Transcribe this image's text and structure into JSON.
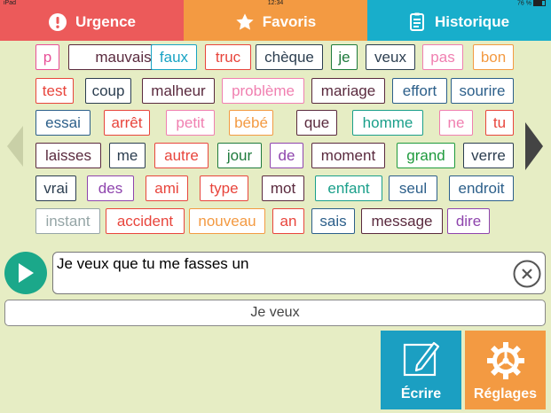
{
  "status": {
    "device": "iPad",
    "time": "12:34",
    "battery": "76 %"
  },
  "tabs": [
    {
      "label": "Urgence",
      "icon": "exclamation-circle-icon",
      "color": "#ec5a5a"
    },
    {
      "label": "Favoris",
      "icon": "star-icon",
      "color": "#f39a42"
    },
    {
      "label": "Historique",
      "icon": "history-list-icon",
      "color": "#18aecb"
    }
  ],
  "words": [
    [
      "p",
      "mauvais",
      "faux",
      "truc",
      "chèque",
      "je",
      "veux",
      "pas",
      "bon"
    ],
    [
      "test",
      "coup",
      "malheur",
      "problème",
      "mariage",
      "effort",
      "sourire"
    ],
    [
      "essai",
      "arrêt",
      "petit",
      "bébé",
      "que",
      "homme",
      "ne",
      "tu"
    ],
    [
      "laisses",
      "me",
      "autre",
      "jour",
      "de",
      "moment",
      "grand",
      "verre"
    ],
    [
      "vrai",
      "des",
      "ami",
      "type",
      "mot",
      "enfant",
      "seul",
      "endroit"
    ],
    [
      "instant",
      "accident",
      "nouveau",
      "an",
      "sais",
      "message",
      "dire"
    ]
  ],
  "message": {
    "text": "Je veux que tu me fasses un"
  },
  "suggestion": {
    "text": "Je veux"
  },
  "buttons": {
    "write": "Écrire",
    "settings": "Réglages"
  }
}
